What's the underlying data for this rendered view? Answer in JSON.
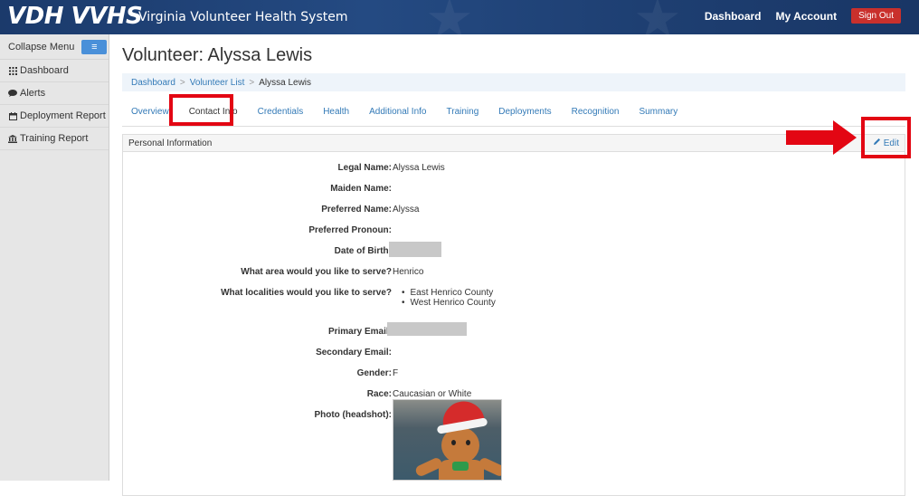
{
  "header": {
    "brand": "VDH VVHS",
    "subtitle": "Virginia Volunteer Health System",
    "nav": [
      "Dashboard",
      "My Account"
    ],
    "signout_label": "Sign Out"
  },
  "sidebar": {
    "collapse_label": "Collapse Menu",
    "collapse_icon": "≡",
    "items": [
      {
        "label": "Dashboard",
        "icon": "grid-icon"
      },
      {
        "label": "Alerts",
        "icon": "chat-icon"
      },
      {
        "label": "Deployment Report",
        "icon": "calendar-icon"
      },
      {
        "label": "Training Report",
        "icon": "bank-icon"
      }
    ]
  },
  "page": {
    "title": "Volunteer: Alyssa Lewis",
    "breadcrumb": [
      "Dashboard",
      "Volunteer List",
      "Alyssa Lewis"
    ],
    "tabs": [
      "Overview",
      "Contact Info",
      "Credentials",
      "Health",
      "Additional Info",
      "Training",
      "Deployments",
      "Recognition",
      "Summary"
    ],
    "active_tab": "Contact Info"
  },
  "panel": {
    "title": "Personal Information",
    "edit_label": "Edit",
    "fields": [
      {
        "label": "Legal Name:",
        "value": "Alyssa Lewis"
      },
      {
        "label": "Maiden Name:",
        "value": ""
      },
      {
        "label": "Preferred Name:",
        "value": "Alyssa"
      },
      {
        "label": "Preferred Pronoun:",
        "value": ""
      },
      {
        "label": "Date of Birth:",
        "value": ""
      },
      {
        "label": "What area would you like to serve?",
        "value": "Henrico"
      },
      {
        "label": "What localities would you like to serve?",
        "value": ""
      },
      {
        "label": "Primary Email:",
        "value": ""
      },
      {
        "label": "Secondary Email:",
        "value": ""
      },
      {
        "label": "Gender:",
        "value": "F"
      },
      {
        "label": "Race:",
        "value": "Caucasian or White"
      },
      {
        "label": "Photo (headshot):",
        "value": ""
      }
    ],
    "localities": [
      "East Henrico County",
      "West Henrico County"
    ]
  },
  "colors": {
    "header_bg": "#1b3a6b",
    "annotation_red": "#e30613",
    "link_blue": "#337ab7"
  }
}
